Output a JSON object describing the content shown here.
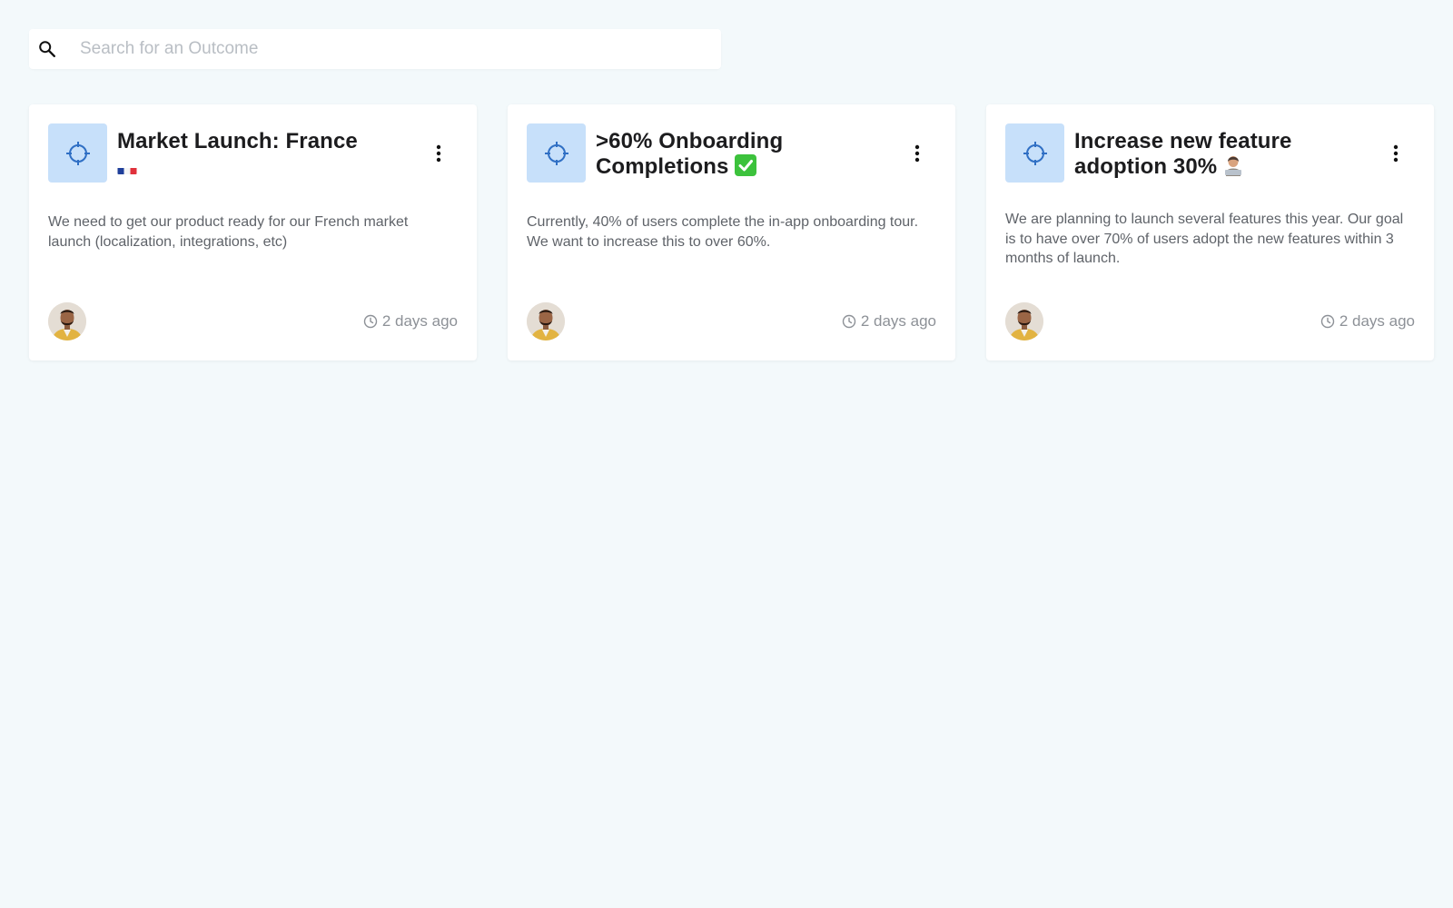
{
  "search": {
    "placeholder": "Search for an Outcome",
    "icon": "search-icon"
  },
  "colors": {
    "background": "#f3f9fb",
    "card_icon_bg": "#c7e0fa",
    "accent_icon": "#2f6fc4",
    "description_text": "#5f6369",
    "timestamp_text": "#8d9197"
  },
  "cards": [
    {
      "icon": "target-icon",
      "title": "Market Launch: France",
      "emoji": "flag-france",
      "description": "We need to get our product ready for our French market launch (localization, integrations, etc)",
      "menu_icon": "more-vertical-icon",
      "timestamp": "2 days ago"
    },
    {
      "icon": "target-icon",
      "title": ">60% Onboarding Completions",
      "emoji": "check-mark-button",
      "description": "Currently, 40% of users complete the in-app onboarding tour. We want to increase this to over 60%.",
      "menu_icon": "more-vertical-icon",
      "timestamp": "2 days ago"
    },
    {
      "icon": "target-icon",
      "title": "Increase new feature adoption 30%",
      "emoji": "person-at-laptop",
      "description": "We are planning to launch several features this year. Our goal is to have over 70% of users adopt the new features within 3 months of launch.",
      "menu_icon": "more-vertical-icon",
      "timestamp": "2 days ago"
    }
  ]
}
